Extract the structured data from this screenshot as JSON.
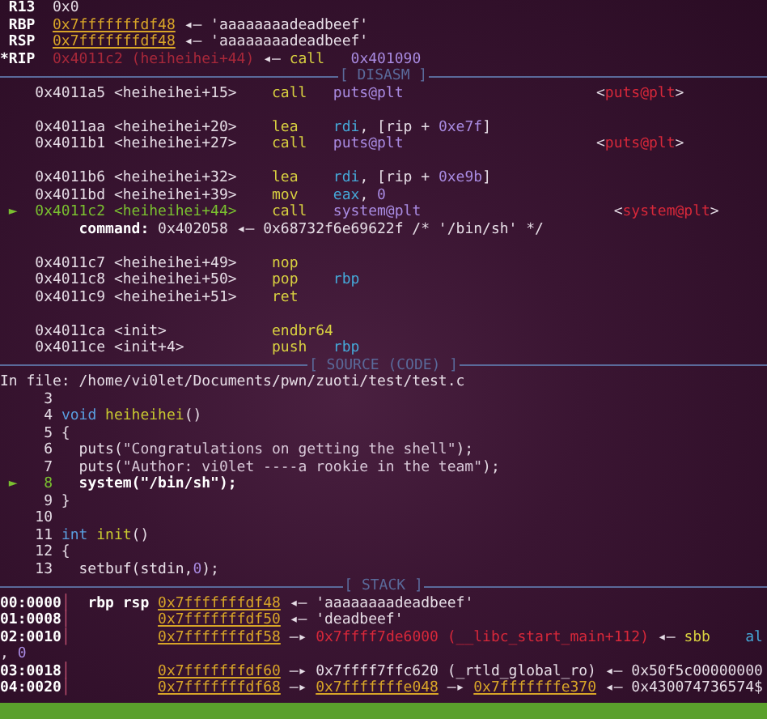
{
  "registers": [
    {
      "segments": [
        {
          "kind": "bold",
          "text": " R13  "
        },
        {
          "kind": "plain",
          "text": "0x0"
        }
      ]
    },
    {
      "segments": [
        {
          "kind": "bold",
          "text": " RBP  "
        },
        {
          "kind": "addr",
          "text": "0x7fffffffdf48"
        },
        {
          "kind": "plain",
          "text": " ◂— 'aaaaaaaadeadbeef'"
        }
      ]
    },
    {
      "segments": [
        {
          "kind": "bold",
          "text": " RSP  "
        },
        {
          "kind": "addr",
          "text": "0x7fffffffdf48"
        },
        {
          "kind": "plain",
          "text": " ◂— 'aaaaaaaadeadbeef'"
        }
      ]
    },
    {
      "segments": [
        {
          "kind": "bold",
          "text": "*RIP  "
        },
        {
          "kind": "dimred",
          "text": "0x4011c2 (heiheihei+44)"
        },
        {
          "kind": "plain",
          "text": " ◂— "
        },
        {
          "kind": "mnem",
          "text": "call"
        },
        {
          "kind": "op",
          "text": "   0x401090"
        }
      ]
    }
  ],
  "disasm": {
    "title": "[ DISASM ]",
    "lines": [
      {
        "kind": "text",
        "segments": [
          {
            "kind": "plain",
            "text": "    0x4011a5 <heiheihei+15>    "
          },
          {
            "kind": "mnem",
            "text": "call   "
          },
          {
            "kind": "op",
            "text": "puts@plt"
          },
          {
            "kind": "plain",
            "text": "                      <"
          },
          {
            "kind": "red",
            "text": "puts@plt"
          },
          {
            "kind": "plain",
            "text": ">"
          }
        ]
      },
      {
        "kind": "blank"
      },
      {
        "kind": "text",
        "segments": [
          {
            "kind": "plain",
            "text": "    0x4011aa <heiheihei+20>    "
          },
          {
            "kind": "mnem",
            "text": "lea    "
          },
          {
            "kind": "reg",
            "text": "rdi"
          },
          {
            "kind": "plain",
            "text": ", [rip + "
          },
          {
            "kind": "op",
            "text": "0xe7f"
          },
          {
            "kind": "plain",
            "text": "]"
          }
        ]
      },
      {
        "kind": "text",
        "segments": [
          {
            "kind": "plain",
            "text": "    0x4011b1 <heiheihei+27>    "
          },
          {
            "kind": "mnem",
            "text": "call   "
          },
          {
            "kind": "op",
            "text": "puts@plt"
          },
          {
            "kind": "plain",
            "text": "                      <"
          },
          {
            "kind": "red",
            "text": "puts@plt"
          },
          {
            "kind": "plain",
            "text": ">"
          }
        ]
      },
      {
        "kind": "blank"
      },
      {
        "kind": "text",
        "segments": [
          {
            "kind": "plain",
            "text": "    0x4011b6 <heiheihei+32>    "
          },
          {
            "kind": "mnem",
            "text": "lea    "
          },
          {
            "kind": "reg",
            "text": "rdi"
          },
          {
            "kind": "plain",
            "text": ", [rip + "
          },
          {
            "kind": "op",
            "text": "0xe9b"
          },
          {
            "kind": "plain",
            "text": "]"
          }
        ]
      },
      {
        "kind": "text",
        "segments": [
          {
            "kind": "plain",
            "text": "    0x4011bd <heiheihei+39>    "
          },
          {
            "kind": "mnem",
            "text": "mov    "
          },
          {
            "kind": "reg",
            "text": "eax"
          },
          {
            "kind": "plain",
            "text": ", "
          },
          {
            "kind": "op",
            "text": "0"
          }
        ]
      },
      {
        "kind": "text",
        "segments": [
          {
            "kind": "cur",
            "text": " ►  0x4011c2 <heiheihei+44>    "
          },
          {
            "kind": "mnem",
            "text": "call   "
          },
          {
            "kind": "op",
            "text": "system@plt"
          },
          {
            "kind": "plain",
            "text": "                      <"
          },
          {
            "kind": "red",
            "text": "system@plt"
          },
          {
            "kind": "plain",
            "text": ">"
          }
        ]
      },
      {
        "kind": "text",
        "segments": [
          {
            "kind": "bold",
            "text": "         command:"
          },
          {
            "kind": "plain",
            "text": " 0x402058 ◂— 0x68732f6e69622f /* '/bin/sh' */"
          }
        ]
      },
      {
        "kind": "blank"
      },
      {
        "kind": "text",
        "segments": [
          {
            "kind": "plain",
            "text": "    0x4011c7 <heiheihei+49>    "
          },
          {
            "kind": "mnem",
            "text": "nop"
          }
        ]
      },
      {
        "kind": "text",
        "segments": [
          {
            "kind": "plain",
            "text": "    0x4011c8 <heiheihei+50>    "
          },
          {
            "kind": "mnem",
            "text": "pop    "
          },
          {
            "kind": "reg",
            "text": "rbp"
          }
        ]
      },
      {
        "kind": "text",
        "segments": [
          {
            "kind": "plain",
            "text": "    0x4011c9 <heiheihei+51>    "
          },
          {
            "kind": "mnem",
            "text": "ret"
          }
        ]
      },
      {
        "kind": "blank"
      },
      {
        "kind": "text",
        "segments": [
          {
            "kind": "plain",
            "text": "    0x4011ca <init>            "
          },
          {
            "kind": "mnem",
            "text": "endbr64"
          }
        ]
      },
      {
        "kind": "text",
        "segments": [
          {
            "kind": "plain",
            "text": "    0x4011ce <init+4>          "
          },
          {
            "kind": "mnem",
            "text": "push   "
          },
          {
            "kind": "reg",
            "text": "rbp"
          }
        ]
      }
    ]
  },
  "source": {
    "title": "[ SOURCE (CODE) ]",
    "file": "In file: /home/vi0let/Documents/pwn/zuoti/test/test.c",
    "lines": [
      {
        "kind": "text",
        "segments": [
          {
            "kind": "plain",
            "text": "     3"
          }
        ]
      },
      {
        "kind": "text",
        "segments": [
          {
            "kind": "plain",
            "text": "     4 "
          },
          {
            "kind": "kw",
            "text": "void"
          },
          {
            "kind": "fn",
            "text": " heiheihei"
          },
          {
            "kind": "plain",
            "text": "()"
          }
        ]
      },
      {
        "kind": "text",
        "segments": [
          {
            "kind": "plain",
            "text": "     5 {"
          }
        ]
      },
      {
        "kind": "text",
        "segments": [
          {
            "kind": "plain",
            "text": "     6   puts("
          },
          {
            "kind": "str",
            "text": "\"Congratulations on getting the shell\""
          },
          {
            "kind": "plain",
            "text": ");"
          }
        ]
      },
      {
        "kind": "text",
        "segments": [
          {
            "kind": "plain",
            "text": "     7   puts("
          },
          {
            "kind": "str",
            "text": "\"Author: vi0let ----a rookie in the team\""
          },
          {
            "kind": "plain",
            "text": ");"
          }
        ]
      },
      {
        "kind": "text",
        "segments": [
          {
            "kind": "cur",
            "text": " ►   8"
          },
          {
            "kind": "bold",
            "text": "   system(\"/bin/sh\");"
          }
        ]
      },
      {
        "kind": "text",
        "segments": [
          {
            "kind": "plain",
            "text": "     9 }"
          }
        ]
      },
      {
        "kind": "text",
        "segments": [
          {
            "kind": "plain",
            "text": "    10"
          }
        ]
      },
      {
        "kind": "text",
        "segments": [
          {
            "kind": "plain",
            "text": "    11 "
          },
          {
            "kind": "kw",
            "text": "int"
          },
          {
            "kind": "fn",
            "text": " init"
          },
          {
            "kind": "plain",
            "text": "()"
          }
        ]
      },
      {
        "kind": "text",
        "segments": [
          {
            "kind": "plain",
            "text": "    12 {"
          }
        ]
      },
      {
        "kind": "text",
        "segments": [
          {
            "kind": "plain",
            "text": "    13   setbuf(stdin,"
          },
          {
            "kind": "op",
            "text": "0"
          },
          {
            "kind": "plain",
            "text": ");"
          }
        ]
      }
    ]
  },
  "stack": {
    "title": "[ STACK ]",
    "lines": [
      {
        "kind": "text",
        "segments": [
          {
            "kind": "bold",
            "text": "00:0000"
          },
          {
            "kind": "sep",
            "text": "│"
          },
          {
            "kind": "bold",
            "text": "  rbp rsp "
          },
          {
            "kind": "addr",
            "text": "0x7fffffffdf48"
          },
          {
            "kind": "plain",
            "text": " ◂— 'aaaaaaaadeadbeef'"
          }
        ]
      },
      {
        "kind": "text",
        "segments": [
          {
            "kind": "bold",
            "text": "01:0008"
          },
          {
            "kind": "sep",
            "text": "│          "
          },
          {
            "kind": "addr",
            "text": "0x7fffffffdf50"
          },
          {
            "kind": "plain",
            "text": " ◂— 'deadbeef'"
          }
        ]
      },
      {
        "kind": "text",
        "segments": [
          {
            "kind": "bold",
            "text": "02:0010"
          },
          {
            "kind": "sep",
            "text": "│          "
          },
          {
            "kind": "addr",
            "text": "0x7fffffffdf58"
          },
          {
            "kind": "plain",
            "text": " —▸ "
          },
          {
            "kind": "red",
            "text": "0x7ffff7de6000 (__libc_start_main+112)"
          },
          {
            "kind": "plain",
            "text": " ◂— "
          },
          {
            "kind": "mnem",
            "text": "sbb"
          },
          {
            "kind": "reg",
            "text": "    al"
          }
        ]
      },
      {
        "kind": "text",
        "segments": [
          {
            "kind": "plain",
            "text": ", "
          },
          {
            "kind": "op",
            "text": "0"
          }
        ]
      },
      {
        "kind": "text",
        "segments": [
          {
            "kind": "bold",
            "text": "03:0018"
          },
          {
            "kind": "sep",
            "text": "│          "
          },
          {
            "kind": "addr",
            "text": "0x7fffffffdf60"
          },
          {
            "kind": "plain",
            "text": " —▸ 0x7ffff7ffc620 (_rtld_global_ro) ◂— 0x50f5c00000000"
          }
        ]
      },
      {
        "kind": "text",
        "segments": [
          {
            "kind": "bold",
            "text": "04:0020"
          },
          {
            "kind": "sep",
            "text": "│          "
          },
          {
            "kind": "addr",
            "text": "0x7fffffffdf68"
          },
          {
            "kind": "plain",
            "text": " —▸ "
          },
          {
            "kind": "addr",
            "text": "0x7fffffffe048"
          },
          {
            "kind": "plain",
            "text": " —▸ "
          },
          {
            "kind": "addr",
            "text": "0x7fffffffe370"
          },
          {
            "kind": "plain",
            "text": " ◂— 0x430074736574$"
          }
        ]
      }
    ]
  }
}
